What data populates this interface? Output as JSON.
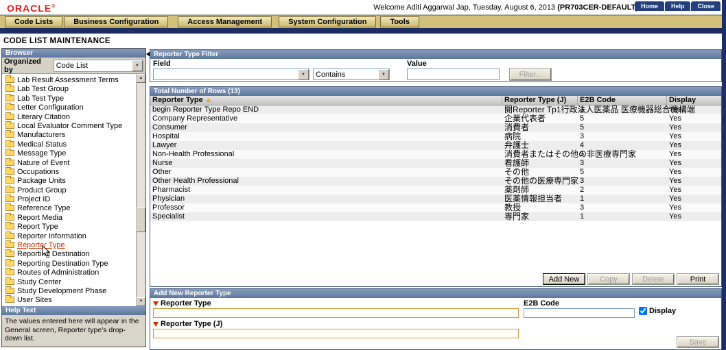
{
  "colors": {
    "oracle_red": "#e21b1b",
    "menu_tan": "#d3c07b",
    "header_blue": "#64799f",
    "navy": "#1c2e63",
    "selected_item_red": "#cc3300",
    "required_marker_red": "#cf2a00"
  },
  "header": {
    "logo": "ORACLE",
    "logo_mark": "®",
    "welcome_text": "Welcome Aditi Aggarwal Jap, Tuesday, August 6, 2013 ",
    "welcome_bold": "(PR703CER-DEFAULT)",
    "buttons": [
      {
        "label": "Home"
      },
      {
        "label": "Help"
      },
      {
        "label": "Close"
      }
    ]
  },
  "menu": {
    "items": [
      {
        "label": "Code Lists"
      },
      {
        "label": "Business Configuration"
      },
      {
        "label": "Access Management"
      },
      {
        "label": "System Configuration"
      },
      {
        "label": "Tools"
      }
    ]
  },
  "page_title": "CODE LIST MAINTENANCE",
  "browser": {
    "title": "Browser",
    "organized_by_label": "Organized by",
    "organized_by_value": "Code List",
    "selected_item": "Reporter Type",
    "items": [
      "Lab Result Assessment Terms",
      "Lab Test Group",
      "Lab Test Type",
      "Letter Configuration",
      "Literary Citation",
      "Local Evaluator Comment Type",
      "Manufacturers",
      "Medical Status",
      "Message Type",
      "Nature of Event",
      "Occupations",
      "Package Units",
      "Product Group",
      "Project ID",
      "Reference Type",
      "Report Media",
      "Report Type",
      "Reporter Information",
      "Reporter Type",
      "Reporting Destination",
      "Reporting Destination Type",
      "Routes of Administration",
      "Study Center",
      "Study Development Phase",
      "User Sites"
    ]
  },
  "help": {
    "title": "Help Text",
    "body": "The values entered here will appear in the General screen, Reporter type's drop-down list."
  },
  "filter": {
    "title": "Reporter Type Filter",
    "field_label": "Field",
    "field_value": "",
    "operator_value": "Contains",
    "value_label": "Value",
    "value_text": "",
    "filter_button": "Filter..."
  },
  "table": {
    "title": "Total Number of Rows (13)",
    "columns": [
      "Reporter Type",
      "Reporter Type (J)",
      "E2B Code",
      "Display"
    ],
    "rows": [
      [
        "begin Reporter Type Repo END",
        "開Reporter Tp1行政法人医薬品 医療機器総合機構端",
        "3",
        "Yes"
      ],
      [
        "Company Representative",
        "企業代表者",
        "5",
        "Yes"
      ],
      [
        "Consumer",
        "消費者",
        "5",
        "Yes"
      ],
      [
        "Hospital",
        "病院",
        "3",
        "Yes"
      ],
      [
        "Lawyer",
        "弁護士",
        "4",
        "Yes"
      ],
      [
        "Non-Health Professional",
        "消費者またはその他の非医療専門家",
        "5",
        "Yes"
      ],
      [
        "Nurse",
        "看護師",
        "3",
        "Yes"
      ],
      [
        "Other",
        "その他",
        "5",
        "Yes"
      ],
      [
        "Other Health Professional",
        "その他の医療専門家",
        "3",
        "Yes"
      ],
      [
        "Pharmacist",
        "薬剤師",
        "2",
        "Yes"
      ],
      [
        "Physician",
        "医薬情報担当者",
        "1",
        "Yes"
      ],
      [
        "Professor",
        "教授",
        "3",
        "Yes"
      ],
      [
        "Specialist",
        "専門家",
        "1",
        "Yes"
      ]
    ],
    "actions": [
      {
        "label": "Add New",
        "enabled": true,
        "primary": true
      },
      {
        "label": "Copy",
        "enabled": false
      },
      {
        "label": "Delete",
        "enabled": false
      },
      {
        "label": "Print",
        "enabled": true
      }
    ]
  },
  "add_form": {
    "title": "Add New Reporter Type",
    "reporter_type_label": "Reporter Type",
    "reporter_type_value": "",
    "e2b_code_label": "E2B Code",
    "e2b_code_value": "",
    "display_label": "Display",
    "display_checked": true,
    "reporter_type_j_label": "Reporter Type (J)",
    "reporter_type_j_value": "",
    "save_button": "Save"
  }
}
